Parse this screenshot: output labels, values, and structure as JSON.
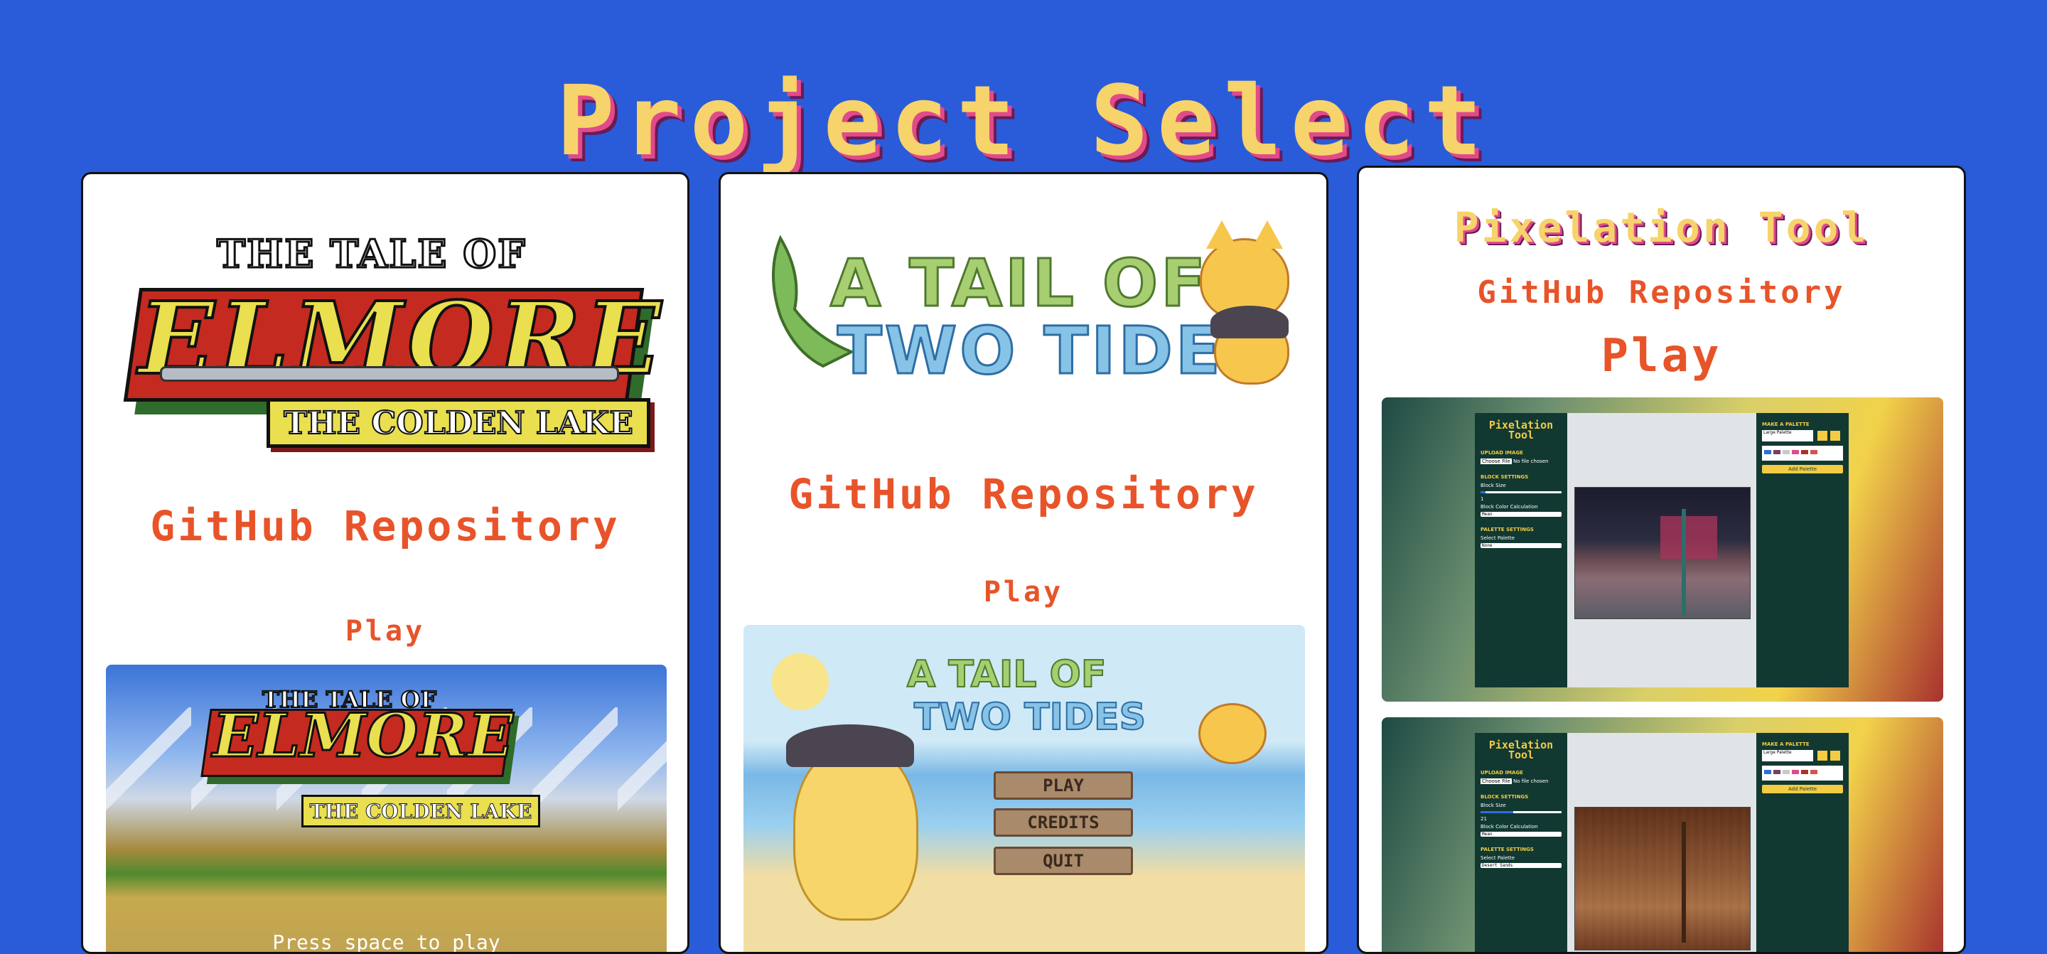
{
  "page": {
    "title": "Project Select",
    "background": "#2a5cd9",
    "accent": "#e8542a"
  },
  "cards": [
    {
      "logo": {
        "line1": "THE TALE OF",
        "line2": "ELMORE",
        "line3": "THE COLDEN LAKE"
      },
      "github_label": "GitHub Repository",
      "play_label": "Play",
      "screenshot": {
        "line1": "THE TALE OF",
        "line2": "ELMORE",
        "line3": "THE COLDEN LAKE",
        "prompt": "Press space to play"
      }
    },
    {
      "logo": {
        "line1": "A TAIL OF",
        "line2": "TWO TIDES"
      },
      "github_label": "GitHub Repository",
      "play_label": "Play",
      "screenshot": {
        "line1": "A TAIL OF",
        "line2": "TWO TIDES",
        "menu": [
          "PLAY",
          "CREDITS",
          "QUIT"
        ]
      }
    },
    {
      "title": "Pixelation Tool",
      "github_label": "GitHub Repository",
      "play_label": "Play",
      "app": {
        "title": "Pixelation Tool",
        "upload_heading": "UPLOAD IMAGE",
        "file_button": "Choose File",
        "file_note": "No file chosen",
        "block_heading": "BLOCK SETTINGS",
        "block_size_label": "Block Size",
        "block_color_label": "Block Color Calculation",
        "block_color_value": "Mean",
        "palette_heading": "PALETTE SETTINGS",
        "select_palette_label": "Select Palette",
        "right_heading": "MAKE A PALETTE",
        "palette_name": "Large Palette",
        "add_palette": "Add Palette"
      },
      "shots": [
        {
          "block_size": "1",
          "palette": "None"
        },
        {
          "block_size": "21",
          "palette": "Desert Sands"
        }
      ]
    }
  ]
}
